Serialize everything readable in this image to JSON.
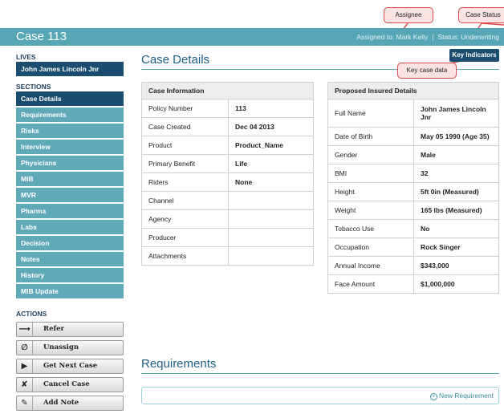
{
  "annotations": {
    "assignee": "Assignee",
    "case_status": "Case Status",
    "key_case_data": "Key case data"
  },
  "header": {
    "case_title": "Case 113",
    "assigned_to": "Assigned to: Mark Kelly",
    "separator": "|",
    "status": "Status: Underwriting"
  },
  "sidebar": {
    "lives_heading": "LIVES",
    "lives_item": "John James Lincoln Jnr",
    "sections_heading": "SECTIONS",
    "sections": [
      "Case Details",
      "Requirements",
      "Risks",
      "Interview",
      "Physicians",
      "MIB",
      "MVR",
      "Pharma",
      "Labs",
      "Decision",
      "Notes",
      "History",
      "MIB Update"
    ],
    "actions_heading": "ACTIONS",
    "actions": [
      {
        "label": "Refer",
        "icon": "arrow-right-icon",
        "glyph": "⟶"
      },
      {
        "label": "Unassign",
        "icon": "empty-set-icon",
        "glyph": "∅"
      },
      {
        "label": "Get Next Case",
        "icon": "play-icon",
        "glyph": "▶"
      },
      {
        "label": "Cancel Case",
        "icon": "cross-icon",
        "glyph": "✘"
      },
      {
        "label": "Add Note",
        "icon": "pencil-icon",
        "glyph": "✎"
      }
    ]
  },
  "main": {
    "case_details_title": "Case Details",
    "key_indicators_label": "Key Indicators",
    "case_info": {
      "heading": "Case Information",
      "rows": [
        [
          "Policy Number",
          "113"
        ],
        [
          "Case Created",
          "Dec 04 2013"
        ],
        [
          "Product",
          "Product_Name"
        ],
        [
          "Primary Benefit",
          "Life"
        ],
        [
          "Riders",
          "None"
        ],
        [
          "Channel",
          ""
        ],
        [
          "Agency",
          ""
        ],
        [
          "Producer",
          ""
        ],
        [
          "Attachments",
          ""
        ]
      ]
    },
    "insured_details": {
      "heading": "Proposed Insured Details",
      "rows": [
        [
          "Full Name",
          "John James Lincoln Jnr"
        ],
        [
          "Date of Birth",
          "May 05 1990 (Age 35)"
        ],
        [
          "Gender",
          "Male"
        ],
        [
          "BMI",
          "32"
        ],
        [
          "Height",
          "5ft 0in (Measured)"
        ],
        [
          "Weight",
          "165 lbs (Measured)"
        ],
        [
          "Tobacco Use",
          "No"
        ],
        [
          "Occupation",
          "Rock Singer"
        ],
        [
          "Annual Income",
          "$343,000"
        ],
        [
          "Face Amount",
          "$1,000,000"
        ]
      ]
    },
    "requirements_title": "Requirements",
    "new_requirement_label": "New Requirement"
  },
  "colors": {
    "header_teal": "#57a6b6",
    "nav_teal": "#5fa9b9",
    "active_navy": "#1a4d70",
    "title_blue": "#1f5f87",
    "callout_red": "#d64a4a"
  }
}
